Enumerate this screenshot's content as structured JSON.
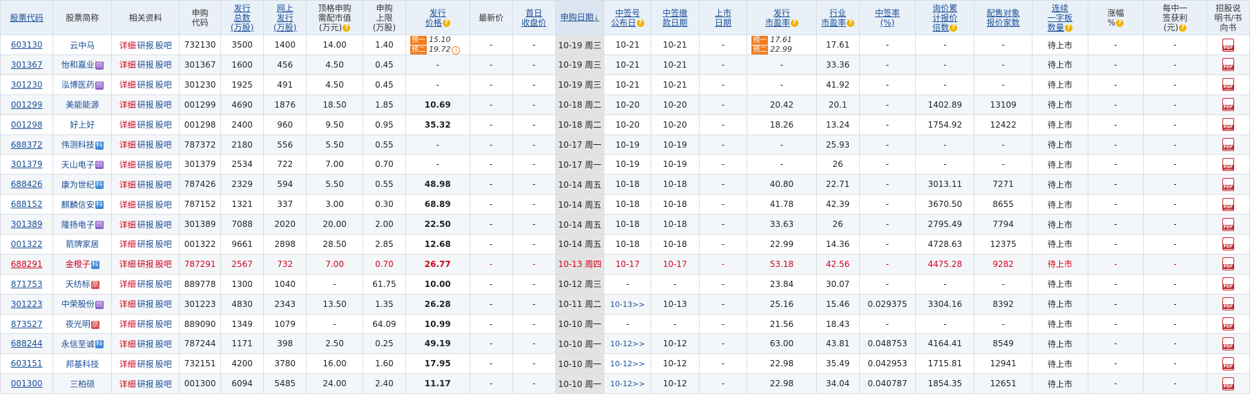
{
  "headers": [
    {
      "label": "股票代码",
      "blue": true
    },
    {
      "label": "股票简称",
      "blue": false
    },
    {
      "label": "相关资料",
      "blue": false
    },
    {
      "label": "申购\n代码",
      "blue": false
    },
    {
      "label": "发行\n总数\n(万股)",
      "blue": true
    },
    {
      "label": "网上\n发行\n(万股)",
      "blue": true
    },
    {
      "label": "顶格申购\n需配市值\n(万元)",
      "blue": false,
      "help": true
    },
    {
      "label": "申购\n上限\n(万股)",
      "blue": false
    },
    {
      "label": "发行\n价格",
      "blue": true,
      "help": true
    },
    {
      "label": "最新价",
      "blue": false
    },
    {
      "label": "首日\n收盘价",
      "blue": true
    },
    {
      "label": "申购日期",
      "blue": true,
      "sorted": true
    },
    {
      "label": "中签号\n公布日",
      "blue": true,
      "help": true
    },
    {
      "label": "中签缴\n款日期",
      "blue": true
    },
    {
      "label": "上市\n日期",
      "blue": true
    },
    {
      "label": "发行\n市盈率",
      "blue": true,
      "help": true
    },
    {
      "label": "行业\n市盈率",
      "blue": true,
      "help": true
    },
    {
      "label": "中签率\n(%)",
      "blue": true
    },
    {
      "label": "询价累\n计报价\n倍数",
      "blue": true,
      "help": true
    },
    {
      "label": "配售对象\n报价家数",
      "blue": true
    },
    {
      "label": "连续\n一字板\n数量",
      "blue": true,
      "help": true
    },
    {
      "label": "涨幅\n%",
      "blue": false,
      "help": true
    },
    {
      "label": "每中一\n签获利\n(元)",
      "blue": false,
      "help": true
    },
    {
      "label": "招股说\n明书/书\n向书",
      "blue": false
    }
  ],
  "links": {
    "detail": "详细",
    "research": "研报",
    "forum": "股吧"
  },
  "pre_labels": {
    "first": "预一",
    "second": "预二"
  },
  "help_glyph": "?",
  "sort_glyph": "↓",
  "info_glyph": "i",
  "rows": [
    {
      "code": "603130",
      "name": "云中马",
      "tag": "",
      "sub": "732130",
      "total": "3500",
      "online": "1400",
      "cap": "14.00",
      "limit": "1.40",
      "price": "",
      "pre1": "15.10",
      "pre2": "19.72",
      "latest": "-",
      "firstclose": "-",
      "date": "10-19 周三",
      "lotdate": "10-21",
      "paydate": "10-21",
      "listdate": "-",
      "pe": "",
      "pe1": "17.61",
      "pe2": "22.99",
      "indpe": "17.61",
      "rate": "-",
      "mult": "-",
      "count": "-",
      "board": "待上市",
      "gain": "-",
      "profit": "-"
    },
    {
      "code": "301367",
      "name": "怡和嘉业",
      "tag": "创",
      "sub": "301367",
      "total": "1600",
      "online": "456",
      "cap": "4.50",
      "limit": "0.45",
      "price": "-",
      "latest": "-",
      "firstclose": "-",
      "date": "10-19 周三",
      "lotdate": "10-21",
      "paydate": "10-21",
      "listdate": "-",
      "pe": "-",
      "indpe": "33.36",
      "rate": "-",
      "mult": "-",
      "count": "-",
      "board": "待上市",
      "gain": "-",
      "profit": "-"
    },
    {
      "code": "301230",
      "name": "泓博医药",
      "tag": "创",
      "sub": "301230",
      "total": "1925",
      "online": "491",
      "cap": "4.50",
      "limit": "0.45",
      "price": "-",
      "latest": "-",
      "firstclose": "-",
      "date": "10-19 周三",
      "lotdate": "10-21",
      "paydate": "10-21",
      "listdate": "-",
      "pe": "-",
      "indpe": "41.92",
      "rate": "-",
      "mult": "-",
      "count": "-",
      "board": "待上市",
      "gain": "-",
      "profit": "-"
    },
    {
      "code": "001299",
      "name": "美能能源",
      "tag": "",
      "sub": "001299",
      "total": "4690",
      "online": "1876",
      "cap": "18.50",
      "limit": "1.85",
      "price": "10.69",
      "latest": "-",
      "firstclose": "-",
      "date": "10-18 周二",
      "lotdate": "10-20",
      "paydate": "10-20",
      "listdate": "-",
      "pe": "20.42",
      "indpe": "20.1",
      "rate": "-",
      "mult": "1402.89",
      "count": "13109",
      "board": "待上市",
      "gain": "-",
      "profit": "-"
    },
    {
      "code": "001298",
      "name": "好上好",
      "tag": "",
      "sub": "001298",
      "total": "2400",
      "online": "960",
      "cap": "9.50",
      "limit": "0.95",
      "price": "35.32",
      "latest": "-",
      "firstclose": "-",
      "date": "10-18 周二",
      "lotdate": "10-20",
      "paydate": "10-20",
      "listdate": "-",
      "pe": "18.26",
      "indpe": "13.24",
      "rate": "-",
      "mult": "1754.92",
      "count": "12422",
      "board": "待上市",
      "gain": "-",
      "profit": "-"
    },
    {
      "code": "688372",
      "name": "伟测科技",
      "tag": "科",
      "sub": "787372",
      "total": "2180",
      "online": "556",
      "cap": "5.50",
      "limit": "0.55",
      "price": "-",
      "latest": "-",
      "firstclose": "-",
      "date": "10-17 周一",
      "lotdate": "10-19",
      "paydate": "10-19",
      "listdate": "-",
      "pe": "-",
      "indpe": "25.93",
      "rate": "-",
      "mult": "-",
      "count": "-",
      "board": "待上市",
      "gain": "-",
      "profit": "-"
    },
    {
      "code": "301379",
      "name": "天山电子",
      "tag": "创",
      "sub": "301379",
      "total": "2534",
      "online": "722",
      "cap": "7.00",
      "limit": "0.70",
      "price": "-",
      "latest": "-",
      "firstclose": "-",
      "date": "10-17 周一",
      "lotdate": "10-19",
      "paydate": "10-19",
      "listdate": "-",
      "pe": "-",
      "indpe": "26",
      "rate": "-",
      "mult": "-",
      "count": "-",
      "board": "待上市",
      "gain": "-",
      "profit": "-"
    },
    {
      "code": "688426",
      "name": "康为世纪",
      "tag": "科",
      "sub": "787426",
      "total": "2329",
      "online": "594",
      "cap": "5.50",
      "limit": "0.55",
      "price": "48.98",
      "latest": "-",
      "firstclose": "-",
      "date": "10-14 周五",
      "lotdate": "10-18",
      "paydate": "10-18",
      "listdate": "-",
      "pe": "40.80",
      "indpe": "22.71",
      "rate": "-",
      "mult": "3013.11",
      "count": "7271",
      "board": "待上市",
      "gain": "-",
      "profit": "-"
    },
    {
      "code": "688152",
      "name": "麒麟信安",
      "tag": "科",
      "sub": "787152",
      "total": "1321",
      "online": "337",
      "cap": "3.00",
      "limit": "0.30",
      "price": "68.89",
      "latest": "-",
      "firstclose": "-",
      "date": "10-14 周五",
      "lotdate": "10-18",
      "paydate": "10-18",
      "listdate": "-",
      "pe": "41.78",
      "indpe": "42.39",
      "rate": "-",
      "mult": "3670.50",
      "count": "8655",
      "board": "待上市",
      "gain": "-",
      "profit": "-"
    },
    {
      "code": "301389",
      "name": "隆扬电子",
      "tag": "创",
      "sub": "301389",
      "total": "7088",
      "online": "2020",
      "cap": "20.00",
      "limit": "2.00",
      "price": "22.50",
      "latest": "-",
      "firstclose": "-",
      "date": "10-14 周五",
      "lotdate": "10-18",
      "paydate": "10-18",
      "listdate": "-",
      "pe": "33.63",
      "indpe": "26",
      "rate": "-",
      "mult": "2795.49",
      "count": "7794",
      "board": "待上市",
      "gain": "-",
      "profit": "-"
    },
    {
      "code": "001322",
      "name": "箭牌家居",
      "tag": "",
      "sub": "001322",
      "total": "9661",
      "online": "2898",
      "cap": "28.50",
      "limit": "2.85",
      "price": "12.68",
      "latest": "-",
      "firstclose": "-",
      "date": "10-14 周五",
      "lotdate": "10-18",
      "paydate": "10-18",
      "listdate": "-",
      "pe": "22.99",
      "indpe": "14.36",
      "rate": "-",
      "mult": "4728.63",
      "count": "12375",
      "board": "待上市",
      "gain": "-",
      "profit": "-"
    },
    {
      "code": "688291",
      "name": "金橙子",
      "tag": "科",
      "sub": "787291",
      "total": "2567",
      "online": "732",
      "cap": "7.00",
      "limit": "0.70",
      "price": "26.77",
      "latest": "-",
      "firstclose": "-",
      "date": "10-13 周四",
      "lotdate": "10-17",
      "paydate": "10-17",
      "listdate": "-",
      "pe": "53.18",
      "indpe": "42.56",
      "rate": "-",
      "mult": "4475.28",
      "count": "9282",
      "board": "待上市",
      "gain": "-",
      "profit": "-",
      "highlight": true
    },
    {
      "code": "871753",
      "name": "天纺标",
      "tag": "京",
      "sub": "889778",
      "total": "1300",
      "online": "1040",
      "cap": "-",
      "limit": "61.75",
      "price": "10.00",
      "latest": "-",
      "firstclose": "-",
      "date": "10-12 周三",
      "lotdate": "-",
      "paydate": "-",
      "listdate": "-",
      "pe": "23.84",
      "indpe": "30.07",
      "rate": "-",
      "mult": "-",
      "count": "-",
      "board": "待上市",
      "gain": "-",
      "profit": "-"
    },
    {
      "code": "301223",
      "name": "中荣股份",
      "tag": "创",
      "sub": "301223",
      "total": "4830",
      "online": "2343",
      "cap": "13.50",
      "limit": "1.35",
      "price": "26.28",
      "latest": "-",
      "firstclose": "-",
      "date": "10-11 周二",
      "lotdate": "10-13>>",
      "lotlink": true,
      "paydate": "10-13",
      "listdate": "-",
      "pe": "25.16",
      "indpe": "15.46",
      "rate": "0.029375",
      "mult": "3304.16",
      "count": "8392",
      "board": "待上市",
      "gain": "-",
      "profit": "-"
    },
    {
      "code": "873527",
      "name": "夜光明",
      "tag": "京",
      "sub": "889090",
      "total": "1349",
      "online": "1079",
      "cap": "-",
      "limit": "64.09",
      "price": "10.99",
      "latest": "-",
      "firstclose": "-",
      "date": "10-10 周一",
      "lotdate": "-",
      "paydate": "-",
      "listdate": "-",
      "pe": "21.56",
      "indpe": "18.43",
      "rate": "-",
      "mult": "-",
      "count": "-",
      "board": "待上市",
      "gain": "-",
      "profit": "-"
    },
    {
      "code": "688244",
      "name": "永信至诚",
      "tag": "科",
      "sub": "787244",
      "total": "1171",
      "online": "398",
      "cap": "2.50",
      "limit": "0.25",
      "price": "49.19",
      "latest": "-",
      "firstclose": "-",
      "date": "10-10 周一",
      "lotdate": "10-12>>",
      "lotlink": true,
      "paydate": "10-12",
      "listdate": "-",
      "pe": "63.00",
      "indpe": "43.81",
      "rate": "0.048753",
      "mult": "4164.41",
      "count": "8549",
      "board": "待上市",
      "gain": "-",
      "profit": "-"
    },
    {
      "code": "603151",
      "name": "邦基科技",
      "tag": "",
      "sub": "732151",
      "total": "4200",
      "online": "3780",
      "cap": "16.00",
      "limit": "1.60",
      "price": "17.95",
      "latest": "-",
      "firstclose": "-",
      "date": "10-10 周一",
      "lotdate": "10-12>>",
      "lotlink": true,
      "paydate": "10-12",
      "listdate": "-",
      "pe": "22.98",
      "indpe": "35.49",
      "rate": "0.042953",
      "mult": "1715.81",
      "count": "12941",
      "board": "待上市",
      "gain": "-",
      "profit": "-"
    },
    {
      "code": "001300",
      "name": "三柏硕",
      "tag": "",
      "sub": "001300",
      "total": "6094",
      "online": "5485",
      "cap": "24.00",
      "limit": "2.40",
      "price": "11.17",
      "latest": "-",
      "firstclose": "-",
      "date": "10-10 周一",
      "lotdate": "10-12>>",
      "lotlink": true,
      "paydate": "10-12",
      "listdate": "-",
      "pe": "22.98",
      "indpe": "34.04",
      "rate": "0.040787",
      "mult": "1854.35",
      "count": "12651",
      "board": "待上市",
      "gain": "-",
      "profit": "-"
    }
  ]
}
